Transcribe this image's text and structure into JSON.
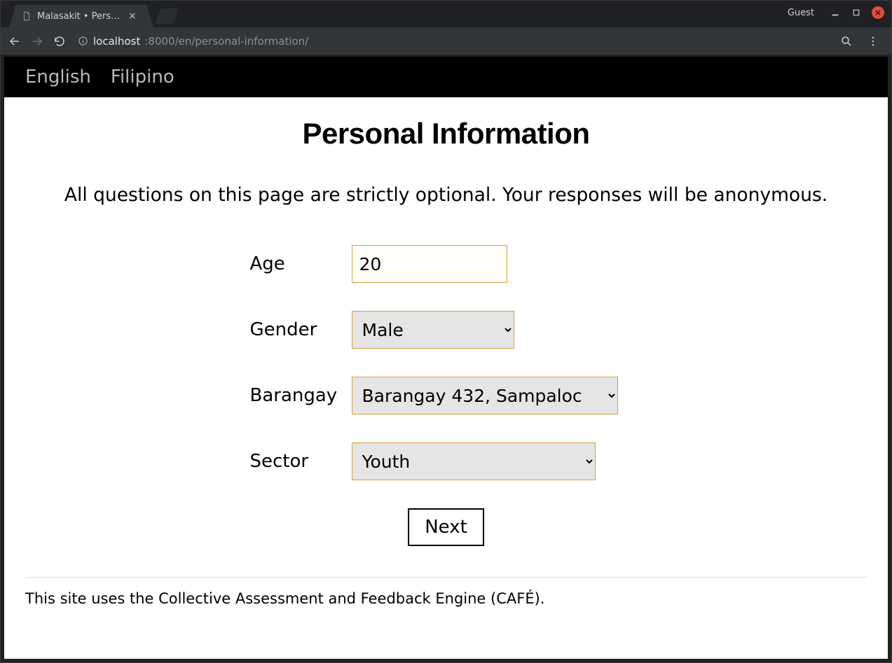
{
  "browser": {
    "tab_title": "Malasakit • Persona",
    "guest_label": "Guest",
    "url_host": "localhost",
    "url_port_path": ":8000/en/personal-information/"
  },
  "site_nav": {
    "english": "English",
    "filipino": "Filipino"
  },
  "page": {
    "title": "Personal Information",
    "subtitle": "All questions on this page are strictly optional. Your responses will be anonymous."
  },
  "form": {
    "age_label": "Age",
    "age_value": "20",
    "gender_label": "Gender",
    "gender_value": "Male",
    "barangay_label": "Barangay",
    "barangay_value": "Barangay 432, Sampaloc",
    "sector_label": "Sector",
    "sector_value": "Youth",
    "next_label": "Next"
  },
  "footer": {
    "note": "This site uses the Collective Assessment and Feedback Engine (CAFÉ)."
  }
}
